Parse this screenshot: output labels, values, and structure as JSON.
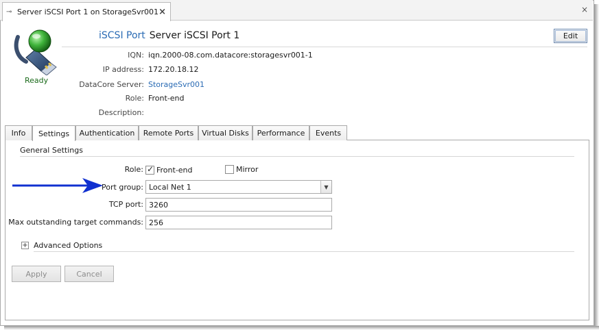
{
  "document_tab": {
    "title": "Server iSCSI Port 1 on StorageSvr001",
    "close": "×"
  },
  "window_close": "×",
  "header": {
    "type_label": "iSCSI Port",
    "name": "Server iSCSI Port 1",
    "status": "Ready",
    "edit_label": "Edit",
    "icon": "network-port-icon"
  },
  "properties": [
    {
      "label": "IQN:",
      "value": "iqn.2000-08.com.datacore:storagesvr001-1",
      "link": false
    },
    {
      "label": "IP address:",
      "value": "172.20.18.12",
      "link": false
    },
    {
      "label": "DataCore Server:",
      "value": "StorageSvr001",
      "link": true
    },
    {
      "label": "Role:",
      "value": "Front-end",
      "link": false
    },
    {
      "label": "Description:",
      "value": "",
      "link": false
    }
  ],
  "tabs": [
    {
      "label": "Info",
      "active": false
    },
    {
      "label": "Settings",
      "active": true
    },
    {
      "label": "Authentication",
      "active": false
    },
    {
      "label": "Remote Ports",
      "active": false
    },
    {
      "label": "Virtual Disks",
      "active": false
    },
    {
      "label": "Performance",
      "active": false
    },
    {
      "label": "Events",
      "active": false
    }
  ],
  "settings": {
    "section_title": "General Settings",
    "role_label": "Role:",
    "role_frontend": {
      "label": "Front-end",
      "checked": true
    },
    "role_mirror": {
      "label": "Mirror",
      "checked": false
    },
    "port_group_label": "Port group:",
    "port_group_value": "Local Net 1",
    "tcp_port_label": "TCP port:",
    "tcp_port_value": "3260",
    "max_commands_label": "Max outstanding target commands:",
    "max_commands_value": "256",
    "advanced_label": "Advanced Options",
    "advanced_expander": "+"
  },
  "buttons": {
    "apply": "Apply",
    "cancel": "Cancel"
  },
  "colors": {
    "accent": "#2a6bb4",
    "status_ready": "#1a6a1a",
    "annotation_arrow": "#1030d0"
  }
}
